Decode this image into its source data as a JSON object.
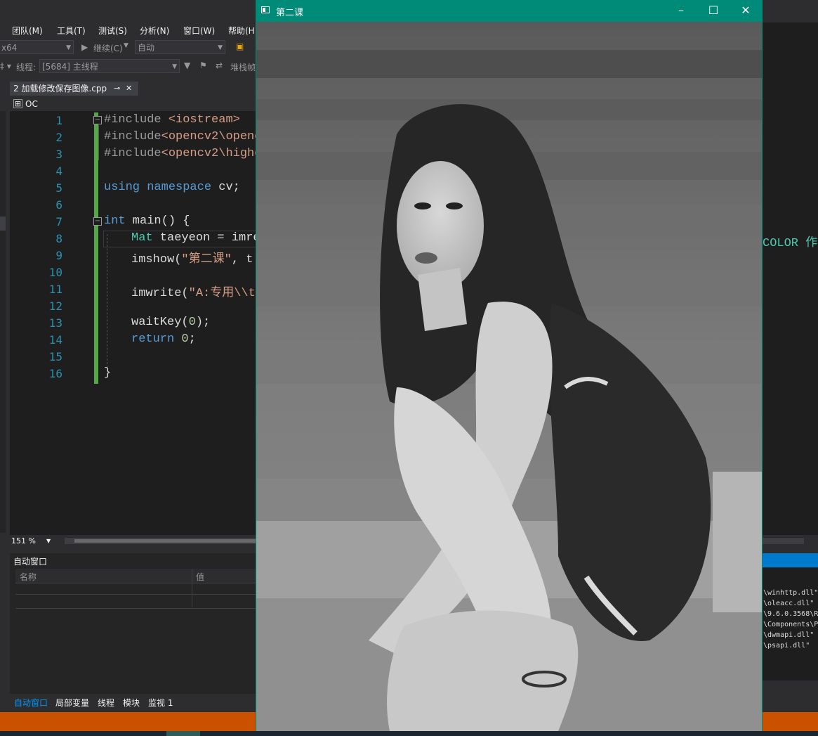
{
  "menu": [
    "团队(M)",
    "工具(T)",
    "测试(S)",
    "分析(N)",
    "窗口(W)",
    "帮助(H)"
  ],
  "toolbar": {
    "platform": "x64",
    "continue_label": "继续(C)",
    "auto_combo": "自动",
    "thread_label": "线程:",
    "thread_value": "[5684] 主线程",
    "stack_label": "堆栈帧"
  },
  "editor": {
    "tab_label": "2 加载修改保存图像.cpp",
    "nav_label": "OC",
    "zoom": "151 %",
    "line_numbers": [
      "1",
      "2",
      "3",
      "4",
      "5",
      "6",
      "7",
      "8",
      "9",
      "10",
      "11",
      "12",
      "13",
      "14",
      "15",
      "16"
    ],
    "lines": {
      "l1a": "#include ",
      "l1b": "<iostream>",
      "l2a": "#include",
      "l2b": "<opencv2\\openc",
      "l3a": "#include",
      "l3b": "<opencv2\\highg",
      "l5a": "using",
      "l5b": "namespace",
      "l5c": " cv;",
      "l7a": "int",
      "l7b": " main() {",
      "l8a": "Mat",
      "l8b": " taeyeon = imre",
      "l8_right": "COLOR 作为",
      "l9a": "imshow(",
      "l9b": "\"第二课\"",
      "l9c": ", t",
      "l11a": "imwrite(",
      "l11b": "\"A:专用\\\\t",
      "l13a": "waitKey(",
      "l13b": "0",
      "l13c": ");",
      "l14a": "return",
      "l14b": " 0",
      "l14c": ";",
      "l16": "}"
    }
  },
  "auto_panel": {
    "title": "自动窗口",
    "col_name": "名称",
    "col_value": "值"
  },
  "bottom_tabs": [
    "自动窗口",
    "局部变量",
    "线程",
    "模块",
    "监视 1"
  ],
  "output_lines": [
    "\\winhttp.dll\"",
    "\\oleacc.dll\"",
    "\\9.6.0.3568\\R",
    "\\Components\\P",
    "\\dwmapi.dll\"",
    "\\psapi.dll\" "
  ],
  "image_window": {
    "title": "第二课",
    "minimize": "–",
    "maximize": "☐",
    "close": "✕"
  },
  "colors": {
    "window_title_bar": "#008a78",
    "status_bar": "#ca5100",
    "editor_bg": "#1e1e1e"
  }
}
